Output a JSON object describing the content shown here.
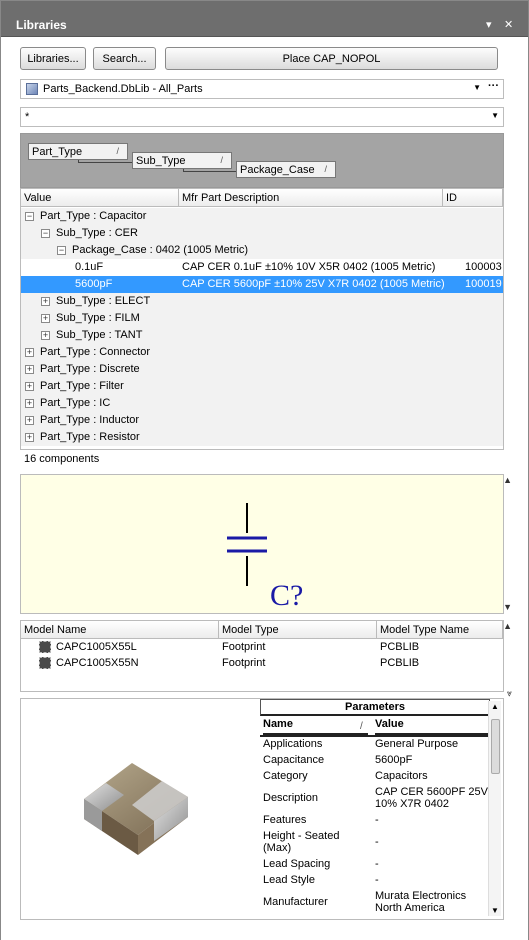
{
  "window": {
    "title": "Libraries",
    "pin_glyph": "▾",
    "close_glyph": "✕"
  },
  "toolbar": {
    "libraries_label": "Libraries...",
    "search_label": "Search...",
    "place_label": "Place CAP_NOPOL"
  },
  "library_select": {
    "value": "Parts_Backend.DbLib - All_Parts",
    "more": "···"
  },
  "filter_select": {
    "value": "*"
  },
  "grouping": {
    "chips": [
      "Part_Type",
      "Sub_Type",
      "Package_Case"
    ],
    "sort_glyph": "/"
  },
  "grid": {
    "headers": [
      "Value",
      "Mfr Part Description",
      "ID"
    ],
    "rows": [
      {
        "indent": 0,
        "expander": "−",
        "value": "Part_Type : Capacitor",
        "desc": "",
        "id": "",
        "group": true
      },
      {
        "indent": 1,
        "expander": "−",
        "value": "Sub_Type : CER",
        "desc": "",
        "id": "",
        "group": true
      },
      {
        "indent": 2,
        "expander": "−",
        "value": "Package_Case : 0402 (1005 Metric)",
        "desc": "",
        "id": "",
        "group": true
      },
      {
        "indent": 3,
        "expander": "",
        "value": "0.1uF",
        "desc": "CAP CER 0.1uF ±10% 10V X5R 0402 (1005 Metric)",
        "id": "100003",
        "group": false
      },
      {
        "indent": 3,
        "expander": "",
        "value": "5600pF",
        "desc": "CAP CER 5600pF ±10% 25V X7R 0402 (1005 Metric)",
        "id": "100019",
        "group": false,
        "selected": true
      },
      {
        "indent": 1,
        "expander": "+",
        "value": "Sub_Type : ELECT",
        "desc": "",
        "id": "",
        "group": true
      },
      {
        "indent": 1,
        "expander": "+",
        "value": "Sub_Type : FILM",
        "desc": "",
        "id": "",
        "group": true
      },
      {
        "indent": 1,
        "expander": "+",
        "value": "Sub_Type : TANT",
        "desc": "",
        "id": "",
        "group": true
      },
      {
        "indent": 0,
        "expander": "+",
        "value": "Part_Type : Connector",
        "desc": "",
        "id": "",
        "group": true
      },
      {
        "indent": 0,
        "expander": "+",
        "value": "Part_Type : Discrete",
        "desc": "",
        "id": "",
        "group": true
      },
      {
        "indent": 0,
        "expander": "+",
        "value": "Part_Type : Filter",
        "desc": "",
        "id": "",
        "group": true
      },
      {
        "indent": 0,
        "expander": "+",
        "value": "Part_Type : IC",
        "desc": "",
        "id": "",
        "group": true
      },
      {
        "indent": 0,
        "expander": "+",
        "value": "Part_Type : Inductor",
        "desc": "",
        "id": "",
        "group": true
      },
      {
        "indent": 0,
        "expander": "+",
        "value": "Part_Type : Resistor",
        "desc": "",
        "id": "",
        "group": true
      }
    ]
  },
  "status": {
    "count_text": "16 components"
  },
  "preview": {
    "designator": "C?",
    "symbol_color": "#1a1aa6"
  },
  "splitters": {
    "up_glyph": "▲",
    "down_glyph": "▼",
    "collapse_glyph": "⩔"
  },
  "models": {
    "headers": [
      "Model Name",
      "Model Type",
      "Model Type Name"
    ],
    "rows": [
      {
        "name": "CAPC1005X55L",
        "type": "Footprint",
        "type_name": "PCBLIB"
      },
      {
        "name": "CAPC1005X55N",
        "type": "Footprint",
        "type_name": "PCBLIB"
      }
    ]
  },
  "parameters": {
    "title": "Parameters",
    "name_header": "Name",
    "value_header": "Value",
    "rows": [
      {
        "name": "Applications",
        "value": "General Purpose"
      },
      {
        "name": "Capacitance",
        "value": "5600pF"
      },
      {
        "name": "Category",
        "value": "Capacitors"
      },
      {
        "name": "Description",
        "value": "CAP CER 5600PF 25V 10% X7R 0402"
      },
      {
        "name": "Features",
        "value": "-"
      },
      {
        "name": "Height - Seated (Max)",
        "value": "-"
      },
      {
        "name": "Lead Spacing",
        "value": "-"
      },
      {
        "name": "Lead Style",
        "value": "-"
      },
      {
        "name": "Manufacturer",
        "value": "Murata Electronics North America"
      }
    ]
  },
  "colors": {
    "selection": "#3399ff",
    "titlebar": "#6e6e6e"
  }
}
